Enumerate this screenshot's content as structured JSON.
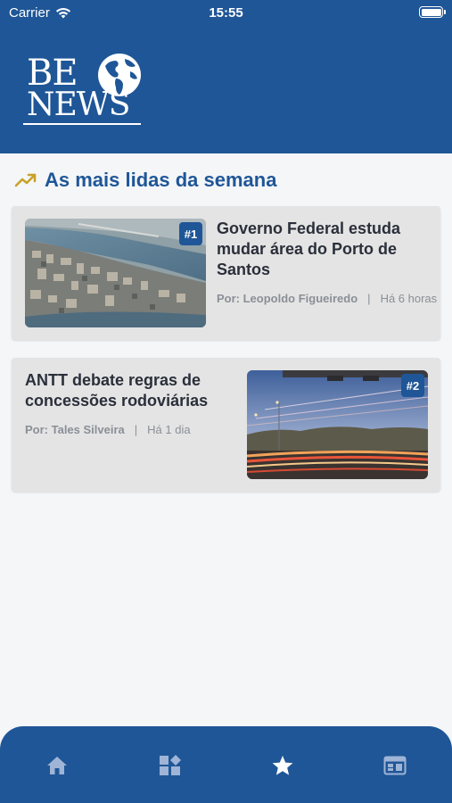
{
  "status_bar": {
    "carrier": "Carrier",
    "time": "15:55"
  },
  "header": {
    "logo_line1": "BE",
    "logo_line2": "NEWS"
  },
  "section": {
    "title": "As mais lidas da semana",
    "icon": "trending-up-icon"
  },
  "articles": [
    {
      "rank": "#1",
      "title": "Governo Federal estuda mudar área do Porto de Santos",
      "author": "Por: Leopoldo Figueiredo",
      "separator": "|",
      "time": "Há 6 horas"
    },
    {
      "rank": "#2",
      "title": "ANTT debate regras de concessões rodoviárias",
      "author": "Por: Tales Silveira",
      "separator": "|",
      "time": "Há 1 dia"
    }
  ],
  "tab_bar": {
    "tabs": [
      {
        "icon": "home-icon"
      },
      {
        "icon": "categories-icon"
      },
      {
        "icon": "star-icon",
        "active": true
      },
      {
        "icon": "calendar-icon"
      }
    ]
  },
  "colors": {
    "brand": "#1f5697",
    "card_bg": "#e4e4e4",
    "accent_icon": "#c8a227"
  }
}
